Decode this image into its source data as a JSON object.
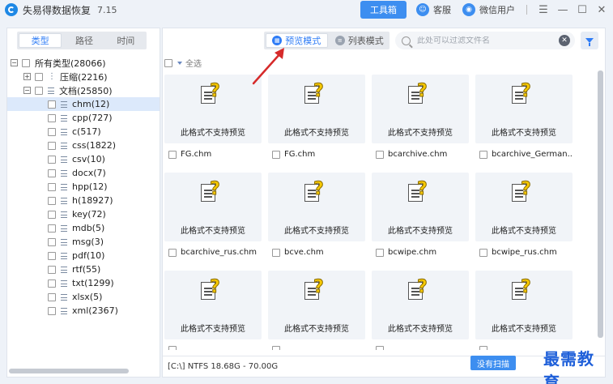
{
  "titlebar": {
    "title": "失易得数据恢复",
    "version": "7.15",
    "toolbox": "工具箱",
    "support": "客服",
    "wechat_user": "微信用户"
  },
  "left": {
    "tabs": [
      "类型",
      "路径",
      "时间"
    ],
    "tree": [
      {
        "label": "所有类型(28066)",
        "level": 0,
        "expander": "−"
      },
      {
        "label": "压缩(2216)",
        "level": 1,
        "expander": "+",
        "icon": "zip-icon"
      },
      {
        "label": "文档(25850)",
        "level": 1,
        "expander": "−",
        "icon": "doc-icon"
      },
      {
        "label": "chm(12)",
        "level": 2,
        "selected": true
      },
      {
        "label": "cpp(727)",
        "level": 2
      },
      {
        "label": "c(517)",
        "level": 2
      },
      {
        "label": "css(1822)",
        "level": 2
      },
      {
        "label": "csv(10)",
        "level": 2
      },
      {
        "label": "docx(7)",
        "level": 2
      },
      {
        "label": "hpp(12)",
        "level": 2
      },
      {
        "label": "h(18927)",
        "level": 2
      },
      {
        "label": "key(72)",
        "level": 2
      },
      {
        "label": "mdb(5)",
        "level": 2
      },
      {
        "label": "msg(3)",
        "level": 2
      },
      {
        "label": "pdf(10)",
        "level": 2
      },
      {
        "label": "rtf(55)",
        "level": 2
      },
      {
        "label": "txt(1299)",
        "level": 2
      },
      {
        "label": "xlsx(5)",
        "level": 2
      },
      {
        "label": "xml(2367)",
        "level": 2
      }
    ]
  },
  "right": {
    "preview_mode": "预览模式",
    "list_mode": "列表模式",
    "search_placeholder": "此处可以过滤文件名",
    "select_all": "全选",
    "unsupported": "此格式不支持预览",
    "files": [
      "FG.chm",
      "FG.chm",
      "bcarchive.chm",
      "bcarchive_German...",
      "bcarchive_rus.chm",
      "bcve.chm",
      "bcwipe.chm",
      "bcwipe_rus.chm",
      "",
      "",
      "",
      ""
    ],
    "status": "[C:\\] NTFS 18.68G - 70.00G",
    "status_button": "没有扫描",
    "watermark": "最需教育"
  }
}
